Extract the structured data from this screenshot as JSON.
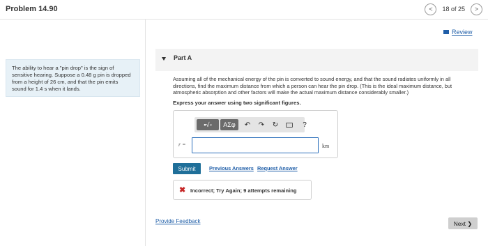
{
  "header": {
    "problem_title": "Problem 14.90",
    "prev_symbol": "<",
    "page_indicator": "18 of 25",
    "next_symbol": ">"
  },
  "review_link": "Review",
  "problem_text": "The ability to hear a \"pin drop\" is the sign of sensitive hearing. Suppose a 0.48 g pin is dropped from a height of 26 cm, and that the pin emits sound for 1.4 s when it lands.",
  "part": {
    "label": "Part A",
    "question": "Assuming all of the mechanical energy of the pin is converted to sound energy, and that the sound radiates uniformly in all directions, find the maximum distance from which a person can hear the pin drop. (This is the ideal maximum distance, but atmospheric absorption and other factors will make the actual maximum distance considerably smaller.)",
    "instruction": "Express your answer using two significant figures."
  },
  "toolbar": {
    "template_label": "▪√▫",
    "greek_label": "ΑΣφ",
    "undo_symbol": "↶",
    "redo_symbol": "↷",
    "reset_symbol": "↻",
    "help_symbol": "?"
  },
  "answer": {
    "variable_label": "r =",
    "value": "",
    "unit": "km"
  },
  "actions": {
    "submit_label": "Submit",
    "previous_answers": "Previous Answers",
    "request_answer": "Request Answer"
  },
  "feedback": {
    "icon": "✖",
    "message": "Incorrect; Try Again; 9 attempts remaining"
  },
  "footer": {
    "provide_feedback": "Provide Feedback",
    "next_label": "Next ❯"
  }
}
